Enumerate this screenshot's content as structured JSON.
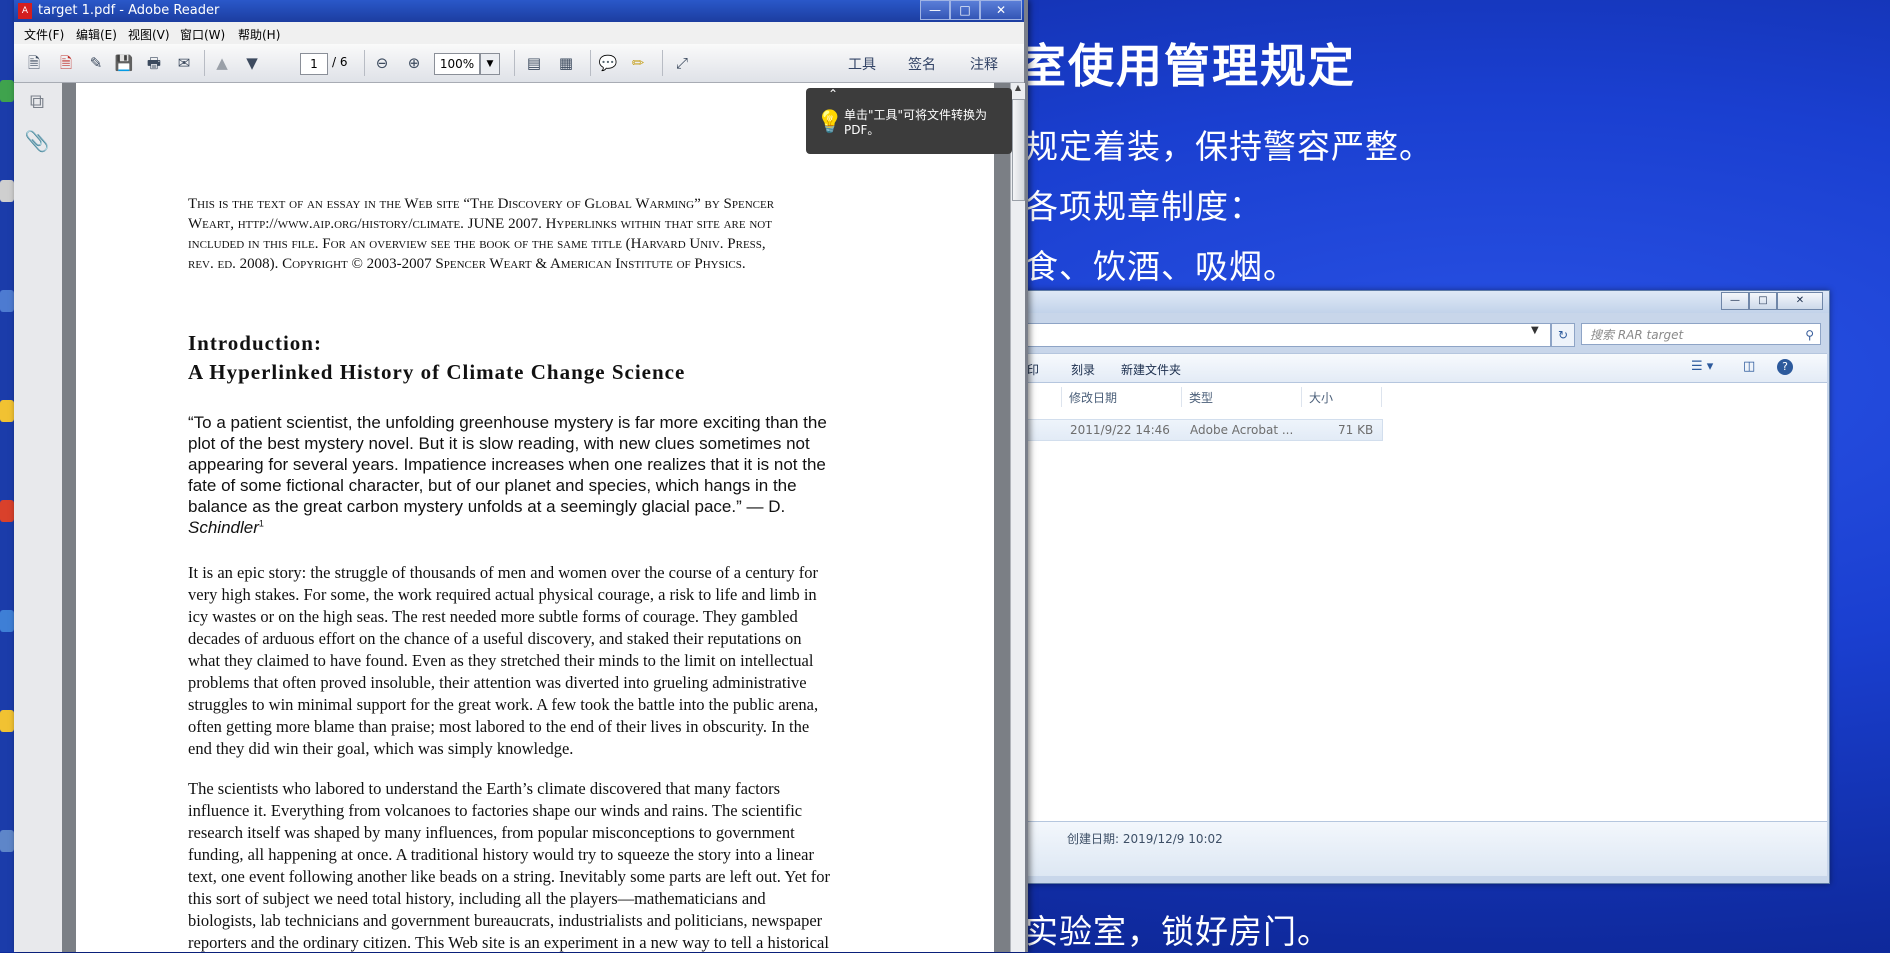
{
  "desktop": {
    "slide_title": "室使用管理规定",
    "slide_lines": [
      "规定着装，保持警容严整。",
      "各项规章制度：",
      "食、饮酒、吸烟。",
      "实验室，锁好房门。"
    ]
  },
  "explorer": {
    "search_placeholder": "搜索 RAR target",
    "toolbar": {
      "print_fragment": "印",
      "burn": "刻录",
      "new_folder": "新建文件夹"
    },
    "columns": {
      "date": "修改日期",
      "type": "类型",
      "size": "大小"
    },
    "file_row": {
      "date": "2011/9/22 14:46",
      "type": "Adobe Acrobat ...",
      "size": "71 KB"
    },
    "details": {
      "created": "创建日期: 2019/12/9 10:02"
    }
  },
  "reader": {
    "title": "target 1.pdf - Adobe Reader",
    "menu": [
      "文件(F)",
      "编辑(E)",
      "视图(V)",
      "窗口(W)",
      "帮助(H)"
    ],
    "page_current": "1",
    "page_total": "/ 6",
    "zoom": "100%",
    "right_tabs": {
      "tools": "工具",
      "sign": "签名",
      "comment": "注释"
    },
    "tooltip": "单击\"工具\"可将文件转换为 PDF。"
  },
  "document": {
    "header_lines": [
      "This is the text of an essay in the Web site “The Discovery of Global Warming” by Spencer",
      "Weart, http://www.aip.org/history/climate. JUNE 2007. Hyperlinks within that site are not",
      "included in this file.  For an overview see the book of the same title (Harvard Univ. Press,",
      "rev. ed. 2008). Copyright © 2003-2007 Spencer Weart & American Institute of Physics."
    ],
    "heading_1": "Introduction:",
    "heading_2": "A Hyperlinked History of Climate Change Science",
    "quote_lines": [
      "“To a patient scientist, the unfolding greenhouse mystery is far more exciting than the",
      "plot of the best mystery novel. But it is slow reading, with new clues sometimes not",
      "appearing for several years. Impatience increases when one realizes that it is not the",
      "fate of some fictional character, but of our planet and species, which hangs in the",
      "balance as the great carbon mystery unfolds at a seemingly glacial pace.” — D.",
      "Schindler"
    ],
    "quote_footnote": "1",
    "para1_lines": [
      "It is an epic story: the struggle of thousands of men and women over the course of a century for",
      "very high stakes. For some, the work required actual physical courage, a risk to life and limb in",
      "icy wastes or on the high seas. The rest needed more subtle forms of courage. They gambled",
      "decades of arduous effort on the chance of a useful discovery, and staked their reputations on",
      "what they claimed to have found. Even as they stretched their minds to the limit on intellectual",
      "problems that often proved insoluble, their attention was diverted into grueling administrative",
      "struggles to win minimal support for the great work. A few took the battle into the public arena,",
      "often getting more blame than praise; most labored to the end of their lives in obscurity. In the",
      "end they did win their goal, which was simply knowledge."
    ],
    "para2_lines": [
      "The scientists who labored to understand the Earth’s climate discovered that many factors",
      "influence it. Everything from volcanoes to factories shape our winds and rains. The scientific",
      "research itself was shaped by many influences, from popular misconceptions to government",
      "funding, all happening at once. A traditional history would try to squeeze the story into a linear",
      "text, one event following another like beads on a string. Inevitably some parts are left out. Yet for",
      "this sort of subject we need total history, including all the players—mathematicians and",
      "biologists, lab technicians and government bureaucrats, industrialists and politicians, newspaper",
      "reporters and the ordinary citizen. This Web site is an experiment in a new way to tell a historical"
    ]
  }
}
